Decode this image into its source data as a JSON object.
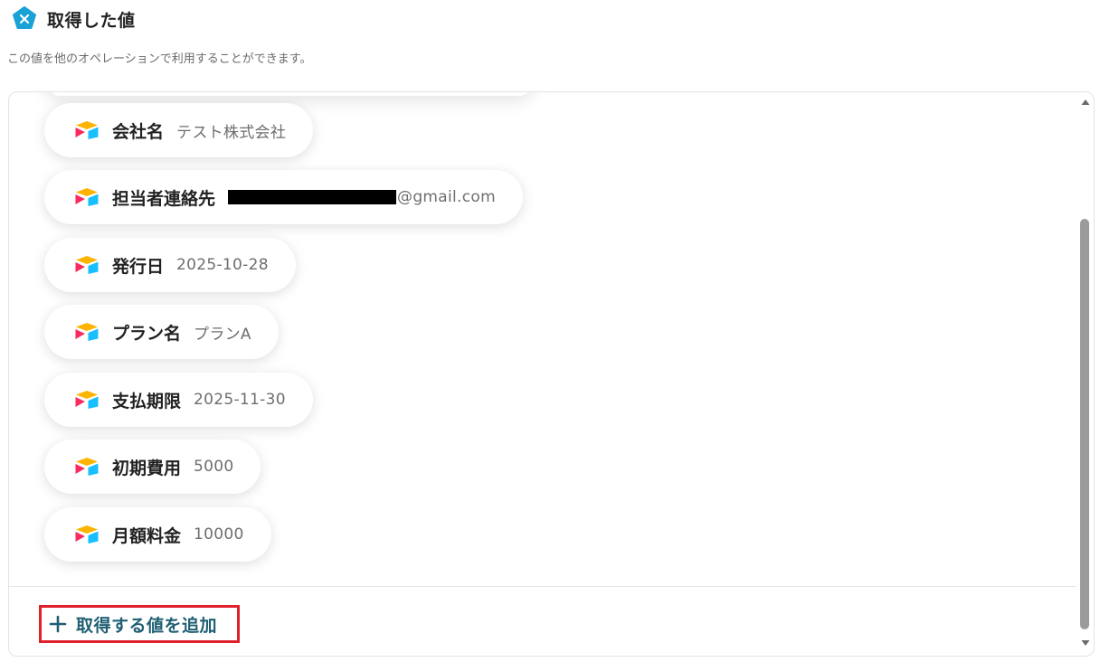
{
  "header": {
    "title": "取得した値",
    "icon": "yoom-logo-icon",
    "icon_color": "#1aa1d6"
  },
  "subtitle": "この値を他のオペレーションで利用することができます。",
  "fields": [
    {
      "name": "会社名",
      "value": "テスト株式会社",
      "icon": "airtable-icon"
    },
    {
      "name": "担当者連絡先",
      "value": "@gmail.com",
      "icon": "airtable-icon",
      "redacted_prefix": true
    },
    {
      "name": "発行日",
      "value": "2025-10-28",
      "icon": "airtable-icon"
    },
    {
      "name": "プラン名",
      "value": "プランA",
      "icon": "airtable-icon"
    },
    {
      "name": "支払期限",
      "value": "2025-11-30",
      "icon": "airtable-icon"
    },
    {
      "name": "初期費用",
      "value": "5000",
      "icon": "airtable-icon"
    },
    {
      "name": "月額料金",
      "value": "10000",
      "icon": "airtable-icon"
    }
  ],
  "add_button": {
    "label": "取得する値を追加",
    "icon": "plus-icon",
    "color": "#1e5f73",
    "highlight_color": "#e0202b"
  },
  "scrollbar": {
    "up_icon": "scroll-up-arrow-icon",
    "down_icon": "scroll-down-arrow-icon"
  }
}
